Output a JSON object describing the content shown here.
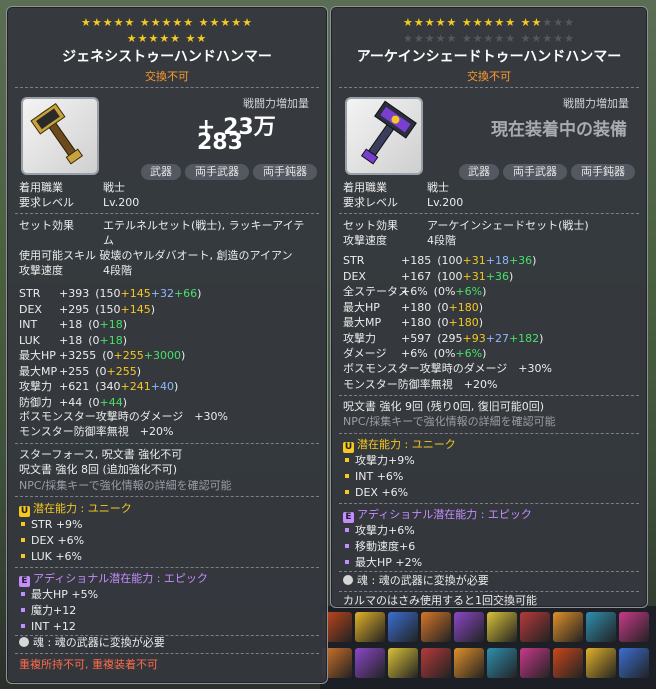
{
  "left": {
    "stars_row1": "★★★★★ ★★★★★ ★★★★★",
    "stars_row2": "★★★★★ ★★",
    "name": "ジェネシストゥーハンドハンマー",
    "trade": "交換不可",
    "attack_label": "戦闘力増加量",
    "attack_value": "+ 23万 283",
    "tags": [
      "武器",
      "両手武器",
      "両手鈍器"
    ],
    "job_label": "着用職業",
    "job_value": "戦士",
    "level_label": "要求レベル",
    "level_value": "Lv.200",
    "set_label": "セット効果",
    "set_value_1": "エテルネルセット(戦士), ラッキーアイテ",
    "set_value_2": "ム",
    "skill_line": "使用可能スキル 破壊のヤルダバオート, 創造のアイアン",
    "speed_label": "攻撃速度",
    "speed_value": "4段階",
    "stats": [
      {
        "label": "STR",
        "total": "+393",
        "base": "(150",
        "a": "+145",
        "b": "+32",
        "c": "+66",
        "close": ")"
      },
      {
        "label": "DEX",
        "total": "+295",
        "base": "(150",
        "a": "+145",
        "close": ")"
      },
      {
        "label": "INT",
        "total": "+18",
        "base": "(0",
        "c": "+18",
        "close": ")"
      },
      {
        "label": "LUK",
        "total": "+18",
        "base": "(0",
        "c": "+18",
        "close": ")"
      },
      {
        "label": "最大HP",
        "total": "+3255",
        "base": "(0",
        "a": "+255",
        "c": "+3000",
        "close": ")"
      },
      {
        "label": "最大MP",
        "total": "+255",
        "base": "(0",
        "a": "+255",
        "close": ")"
      },
      {
        "label": "攻撃力",
        "total": "+621",
        "base": "(340",
        "a": "+241",
        "b": "+40",
        "close": ")"
      },
      {
        "label": "防御力",
        "total": "+44",
        "base": "(0",
        "c": "+44",
        "close": ")"
      }
    ],
    "boss_dmg": "ボスモンスター攻撃時のダメージ　+30%",
    "ignore_def": "モンスター防御率無視　+20%",
    "starforce": "スターフォース, 呪文書 強化不可",
    "scroll": "呪文書 強化 8回 (追加強化不可)",
    "npc_hint": "NPC/採集キーで強化情報の詳細を確認可能",
    "potential_title": "潜在能力 : ユニーク",
    "potential": [
      "STR +9%",
      "DEX +6%",
      "LUK +6%"
    ],
    "add_potential_title": "アディショナル潜在能力 : エピック",
    "add_potential": [
      "最大HP +5%",
      "魔力+12",
      "INT +12"
    ],
    "soul": "魂 : 魂の武器に変換が必要",
    "footer": "重複所持不可, 重複装着不可"
  },
  "right": {
    "stars_row1_on": "★★★★★ ★★★★★ ★★",
    "stars_row1_off": "★★★",
    "stars_row2_off": "★★★★★ ★★★★★ ★★★★★",
    "name": "アーケインシェードトゥーハンドハンマー",
    "trade": "交換不可",
    "attack_label": "戦闘力増加量",
    "equipped": "現在装着中の装備",
    "tags": [
      "武器",
      "両手武器",
      "両手鈍器"
    ],
    "job_label": "着用職業",
    "job_value": "戦士",
    "level_label": "要求レベル",
    "level_value": "Lv.200",
    "set_label": "セット効果",
    "set_value": "アーケインシェードセット(戦士)",
    "speed_label": "攻撃速度",
    "speed_value": "4段階",
    "stats": [
      {
        "label": "STR",
        "total": "+185",
        "base": "(100",
        "a": "+31",
        "b": "+18",
        "c": "+36",
        "close": ")"
      },
      {
        "label": "DEX",
        "total": "+167",
        "base": "(100",
        "a": "+31",
        "c": "+36",
        "close": ")"
      },
      {
        "label": "全ステータス",
        "total": "+6%",
        "base": "(0%",
        "c": "+6%",
        "close": ")"
      },
      {
        "label": "最大HP",
        "total": "+180",
        "base": "(0",
        "a": "+180",
        "close": ")"
      },
      {
        "label": "最大MP",
        "total": "+180",
        "base": "(0",
        "a": "+180",
        "close": ")"
      },
      {
        "label": "攻撃力",
        "total": "+597",
        "base": "(295",
        "a": "+93",
        "b": "+27",
        "c": "+182",
        "close": ")"
      },
      {
        "label": "ダメージ",
        "total": "+6%",
        "base": "(0%",
        "c": "+6%",
        "close": ")"
      }
    ],
    "boss_dmg": "ボスモンスター攻撃時のダメージ　+30%",
    "ignore_def": "モンスター防御率無視　+20%",
    "scroll": "呪文書 強化 9回 (残り0回, 復旧可能0回)",
    "npc_hint": "NPC/採集キーで強化情報の詳細を確認可能",
    "potential_title": "潜在能力 : ユニーク",
    "potential": [
      "攻撃力+9%",
      "INT +6%",
      "DEX +6%"
    ],
    "add_potential_title": "アディショナル潜在能力 : エピック",
    "add_potential": [
      "攻撃力+6%",
      "移動速度+6",
      "最大HP +2%"
    ],
    "soul": "魂 : 魂の武器に変換が必要",
    "karma": "カルマのはさみ使用すると1回交換可能"
  }
}
